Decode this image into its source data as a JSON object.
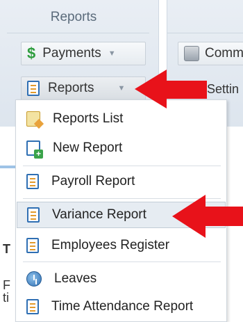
{
  "ribbon": {
    "group_title": "Reports",
    "payments_label": "Payments",
    "reports_label": "Reports",
    "comm_label": "Comm",
    "settings_label": "Settin"
  },
  "menu": {
    "items": [
      {
        "label": "Reports List",
        "icon": "reports-list-icon"
      },
      {
        "label": "New Report",
        "icon": "new-report-icon"
      },
      {
        "label": "Payroll Report",
        "icon": "report-doc-icon"
      },
      {
        "label": "Variance Report",
        "icon": "report-doc-icon"
      },
      {
        "label": "Employees Register",
        "icon": "report-doc-icon"
      },
      {
        "label": "Leaves",
        "icon": "leaves-icon"
      },
      {
        "label": "Time Attendance Report",
        "icon": "report-doc-icon"
      }
    ],
    "highlighted": "Variance Report"
  },
  "background": {
    "chars": [
      "T",
      "F",
      "ti"
    ]
  },
  "colors": {
    "arrow": "#e8121a",
    "ribbon_bg": "#e4eaf1",
    "accent_blue": "#2f6fb3",
    "dollar_green": "#2e9d3e"
  }
}
